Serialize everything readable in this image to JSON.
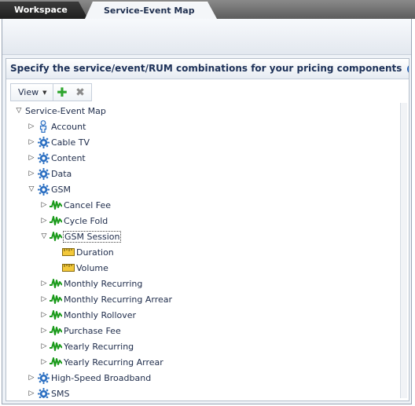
{
  "tabs": [
    {
      "label": "Workspace",
      "active": false
    },
    {
      "label": "Service-Event Map",
      "active": true
    }
  ],
  "panel": {
    "title": "Specify the service/event/RUM combinations for your pricing components",
    "help_icon": "question-circle-icon"
  },
  "toolbar": {
    "view_label": "View",
    "add_icon": "plus-icon",
    "delete_icon": "x-icon"
  },
  "colors": {
    "tab_bar": "#5c5c5c",
    "active_tab": "#f4f6f9",
    "panel_header_text": "#1d3158",
    "add_green": "#2ea52e",
    "event_green": "#1a9a1a",
    "service_blue": "#2b6fc2"
  },
  "tree": [
    {
      "label": "Service-Event Map",
      "level": 0,
      "expander": "▽",
      "icon": "none"
    },
    {
      "label": "Account",
      "level": 1,
      "expander": "▷",
      "icon": "person-icon"
    },
    {
      "label": "Cable TV",
      "level": 1,
      "expander": "▷",
      "icon": "gear-icon"
    },
    {
      "label": "Content",
      "level": 1,
      "expander": "▷",
      "icon": "gear-icon"
    },
    {
      "label": "Data",
      "level": 1,
      "expander": "▷",
      "icon": "gear-icon"
    },
    {
      "label": "GSM",
      "level": 1,
      "expander": "▽",
      "icon": "gear-icon"
    },
    {
      "label": "Cancel Fee",
      "level": 2,
      "expander": "▷",
      "icon": "event-icon"
    },
    {
      "label": "Cycle Fold",
      "level": 2,
      "expander": "▷",
      "icon": "event-icon"
    },
    {
      "label": "GSM Session",
      "level": 2,
      "expander": "▽",
      "icon": "event-icon",
      "selected": true
    },
    {
      "label": "Duration",
      "level": 3,
      "expander": "",
      "icon": "rum-icon"
    },
    {
      "label": "Volume",
      "level": 3,
      "expander": "",
      "icon": "rum-icon"
    },
    {
      "label": "Monthly Recurring",
      "level": 2,
      "expander": "▷",
      "icon": "event-icon"
    },
    {
      "label": "Monthly Recurring Arrear",
      "level": 2,
      "expander": "▷",
      "icon": "event-icon"
    },
    {
      "label": "Monthly Rollover",
      "level": 2,
      "expander": "▷",
      "icon": "event-icon"
    },
    {
      "label": "Purchase Fee",
      "level": 2,
      "expander": "▷",
      "icon": "event-icon"
    },
    {
      "label": "Yearly Recurring",
      "level": 2,
      "expander": "▷",
      "icon": "event-icon"
    },
    {
      "label": "Yearly Recurring Arrear",
      "level": 2,
      "expander": "▷",
      "icon": "event-icon"
    },
    {
      "label": "High-Speed Broadband",
      "level": 1,
      "expander": "▷",
      "icon": "gear-icon"
    },
    {
      "label": "SMS",
      "level": 1,
      "expander": "▷",
      "icon": "gear-icon"
    }
  ]
}
